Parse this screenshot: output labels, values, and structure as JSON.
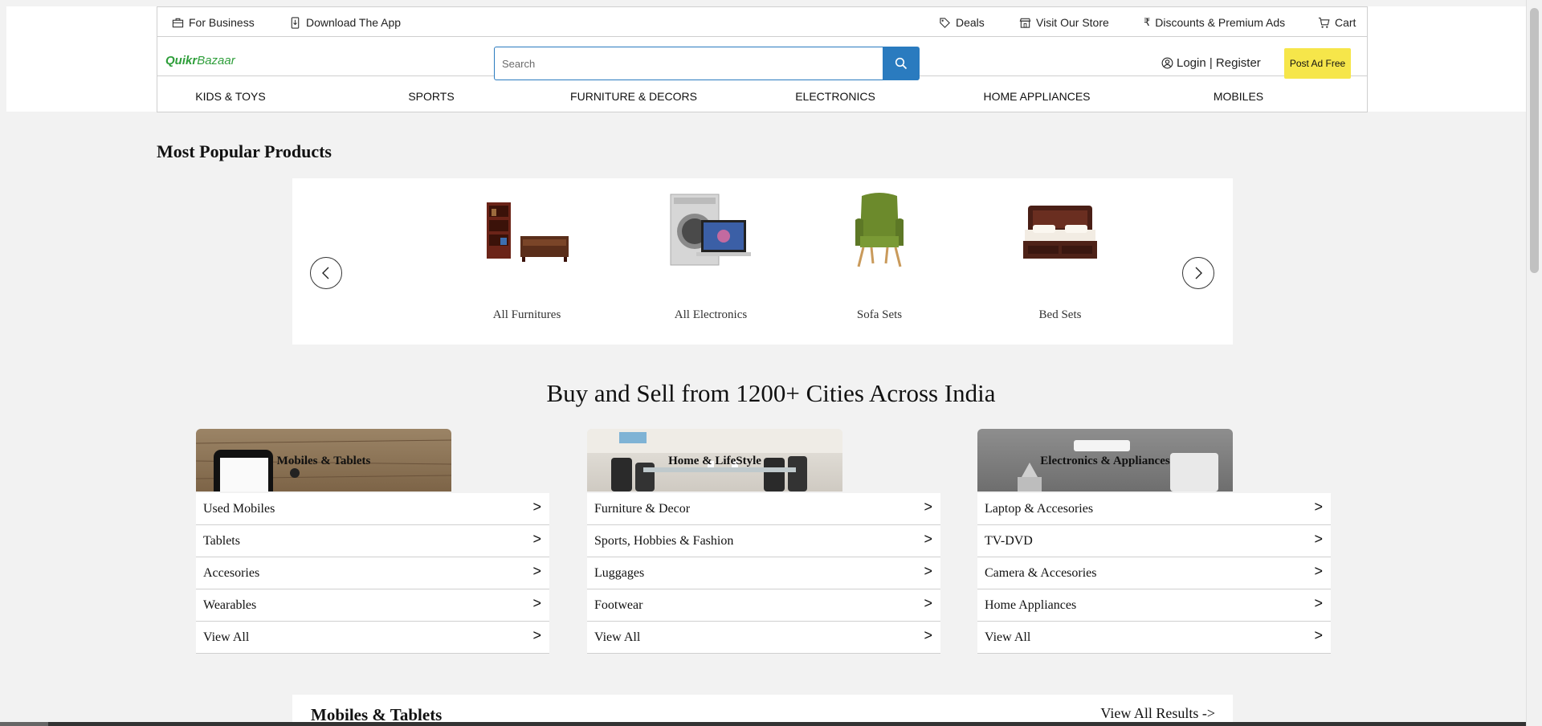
{
  "topbar": {
    "for_business": "For Business",
    "download_app": "Download The App",
    "deals": "Deals",
    "visit_store": "Visit Our Store",
    "discounts": "Discounts & Premium Ads",
    "cart": "Cart"
  },
  "header": {
    "logo_quikr": "Quikr",
    "logo_bazaar": "Bazaar",
    "search_placeholder": "Search",
    "login_register": "Login | Register",
    "post_ad": "Post Ad Free"
  },
  "nav": [
    "KIDS & TOYS",
    "SPORTS",
    "FURNITURE & DECORS",
    "ELECTRONICS",
    "HOME APPLIANCES",
    "MOBILES"
  ],
  "popular": {
    "title": "Most Popular Products",
    "items": [
      "All Furnitures",
      "All Electronics",
      "Sofa Sets",
      "Bed Sets"
    ]
  },
  "cities_title": "Buy and Sell from 1200+ Cities Across India",
  "categories": [
    {
      "name": "Mobiles & Tablets",
      "items": [
        "Used Mobiles",
        "Tablets",
        "Accesories",
        "Wearables",
        "View All"
      ]
    },
    {
      "name": "Home & LifeStyle",
      "items": [
        "Furniture & Decor",
        "Sports, Hobbies & Fashion",
        "Luggages",
        "Footwear",
        "View All"
      ]
    },
    {
      "name": "Electronics & Appliances",
      "items": [
        "Laptop & Accesories",
        "TV-DVD",
        "Camera & Accesories",
        "Home Appliances",
        "View All"
      ]
    }
  ],
  "chevron": ">",
  "bottom": {
    "title": "Mobiles & Tablets",
    "view_all": "View All Results ->"
  },
  "colors": {
    "accent": "#2a7bbf",
    "post_ad_bg": "#f6e64a",
    "logo_green": "#2e9e3a"
  }
}
